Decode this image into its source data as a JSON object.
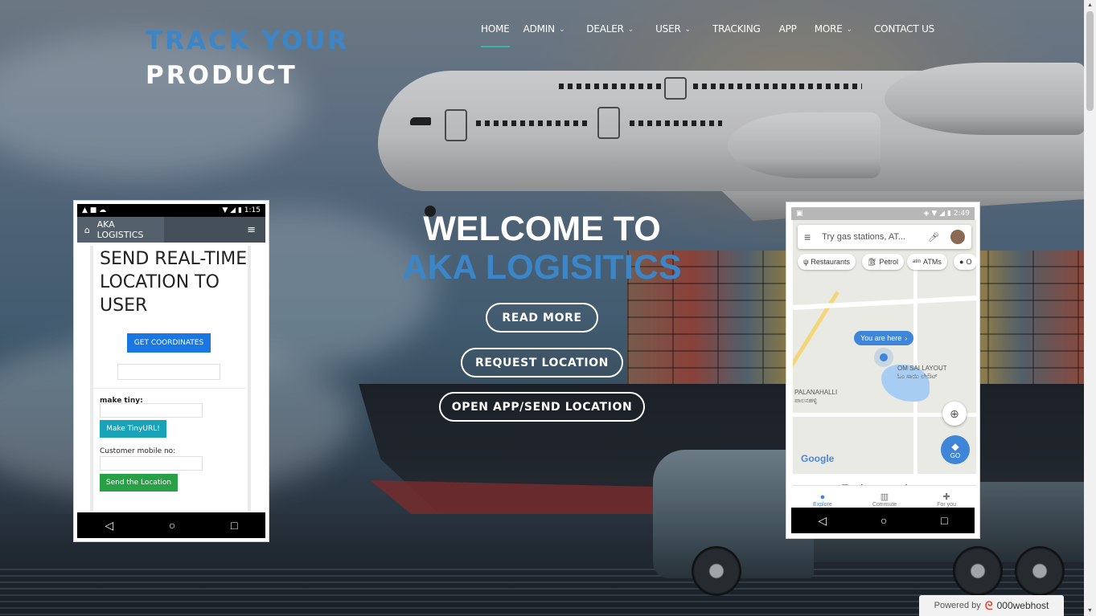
{
  "brand": {
    "line1": "TRACK YOUR",
    "line2": "PRODUCT"
  },
  "nav": {
    "home": "HOME",
    "admin": "ADMIN",
    "dealer": "DEALER",
    "user": "USER",
    "tracking": "TRACKING",
    "app": "APP",
    "more": "MORE",
    "contact": "CONTACT US",
    "chevron": "⌄"
  },
  "hero": {
    "welcome": "WELCOME TO",
    "company": "AKA LOGISITICS",
    "read_more": "READ MORE",
    "request_location": "REQUEST LOCATION",
    "open_app": "OPEN APP/SEND LOCATION"
  },
  "left_phone": {
    "time": "1:15",
    "app_title": "AKA LOGISTICS",
    "heading": "SEND REAL-TIME LOCATION TO USER",
    "get_coordinates": "GET COORDINATES",
    "make_tiny_label": "make tiny:",
    "make_tinyurl": "Make TinyURL!",
    "customer_mobile_label": "Customer mobile no:",
    "send_location": "Send the Location"
  },
  "right_phone": {
    "time": "2:49",
    "search_placeholder": "Try gas stations, AT...",
    "chips": [
      "Restaurants",
      "Petrol",
      "ATMs",
      "O"
    ],
    "you_are_here": "You are here",
    "area_label_1": "OM SAI LAYOUT",
    "area_label_1_local": "ಓಂ ಸಾಯಿ ಲೇಔಟ್",
    "area_label_2": "PALANAHALLI",
    "area_label_2_local": "ಪಾಲನಹಳ್ಳಿ",
    "go": "GO",
    "google": "Google",
    "explore_nearby": "Explore nearby",
    "tabs": [
      "Explore",
      "Commute",
      "For you"
    ]
  },
  "footer": {
    "powered_by": "Powered by",
    "host": "000webhost"
  },
  "colors": {
    "accent_blue": "#3b86c9",
    "nav_active_underline": "#3bb1a9"
  }
}
